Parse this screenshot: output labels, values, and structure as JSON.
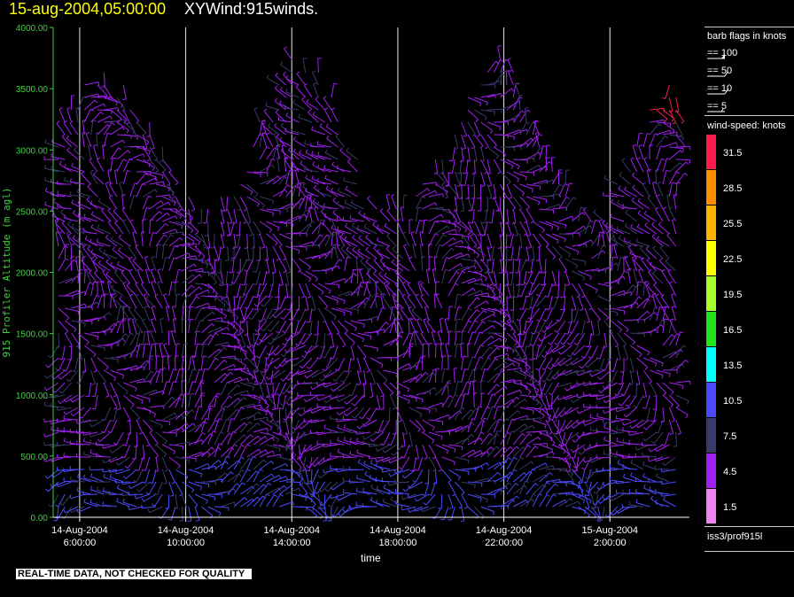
{
  "header": {
    "date_label": "15-aug-2004,05:00:00",
    "title": "XYWind:915winds."
  },
  "legend": {
    "barb_title": "barb flags in knots",
    "barbs": [
      {
        "label": "== 100"
      },
      {
        "label": "== 50"
      },
      {
        "label": "== 10"
      },
      {
        "label": "== 5"
      }
    ],
    "speed_title": "wind-speed: knots",
    "speed_bins": [
      {
        "label": "31.5",
        "color": "#ff1a4a"
      },
      {
        "label": "28.5",
        "color": "#ff8c00"
      },
      {
        "label": "25.5",
        "color": "#ffb300"
      },
      {
        "label": "22.5",
        "color": "#ffff00"
      },
      {
        "label": "19.5",
        "color": "#a8ff2e"
      },
      {
        "label": "16.5",
        "color": "#22e61a"
      },
      {
        "label": "13.5",
        "color": "#00ffff"
      },
      {
        "label": "10.5",
        "color": "#4a4aff"
      },
      {
        "label": "7.5",
        "color": "#3a3a6a"
      },
      {
        "label": "4.5",
        "color": "#a020f0"
      },
      {
        "label": "1.5",
        "color": "#ee82ee"
      }
    ],
    "station": "iss3/prof915l"
  },
  "footer": {
    "quality_note": "REAL-TIME DATA, NOT CHECKED FOR QUALITY"
  },
  "chart_data": {
    "type": "scatter",
    "xlabel": "time",
    "ylabel": "915 Profiler Altitude (m agl)",
    "ylim": [
      0,
      4000
    ],
    "yticks": [
      "0.00",
      "500.00",
      "1000.00",
      "1500.00",
      "2000.00",
      "2500.00",
      "3000.00",
      "3500.00",
      "4000.00"
    ],
    "xticks": [
      {
        "date": "14-Aug-2004",
        "time": "6:00:00"
      },
      {
        "date": "14-Aug-2004",
        "time": "10:00:00"
      },
      {
        "date": "14-Aug-2004",
        "time": "14:00:00"
      },
      {
        "date": "14-Aug-2004",
        "time": "18:00:00"
      },
      {
        "date": "14-Aug-2004",
        "time": "22:00:00"
      },
      {
        "date": "15-Aug-2004",
        "time": "2:00:00"
      }
    ],
    "xlim": [
      "2004-08-14 05:00",
      "2004-08-15 05:00"
    ],
    "vertical_gridlines": true
  }
}
